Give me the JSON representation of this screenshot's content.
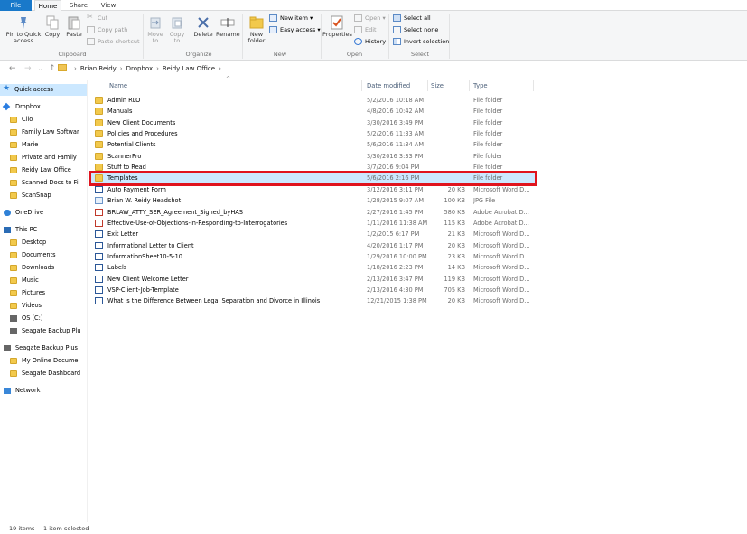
{
  "tabs": {
    "file": "File",
    "home": "Home",
    "share": "Share",
    "view": "View"
  },
  "ribbon": {
    "clipboard": {
      "pin": "Pin to Quick access",
      "copy": "Copy",
      "paste": "Paste",
      "cut": "Cut",
      "copy_path": "Copy path",
      "paste_shortcut": "Paste shortcut",
      "group": "Clipboard"
    },
    "organize": {
      "move_to": "Move to",
      "copy_to": "Copy to",
      "delete": "Delete",
      "rename": "Rename",
      "group": "Organize"
    },
    "new": {
      "new_folder": "New folder",
      "new_item": "New item",
      "easy_access": "Easy access",
      "group": "New"
    },
    "open": {
      "properties": "Properties",
      "open": "Open",
      "edit": "Edit",
      "history": "History",
      "group": "Open"
    },
    "select": {
      "select_all": "Select all",
      "select_none": "Select none",
      "invert": "Invert selection",
      "group": "Select"
    }
  },
  "address": {
    "crumbs": [
      "Brian Reidy",
      "Dropbox",
      "Reidy Law Office"
    ]
  },
  "sidebar": [
    {
      "label": "Quick access",
      "icon": "star-icon"
    },
    {
      "label": "Dropbox",
      "icon": "dropbox-icon"
    },
    {
      "label": "Clio",
      "icon": "folder-icon"
    },
    {
      "label": "Family Law Softwar",
      "icon": "folder-icon"
    },
    {
      "label": "Marie",
      "icon": "folder-icon"
    },
    {
      "label": "Private and Family",
      "icon": "folder-icon"
    },
    {
      "label": "Reidy Law Office",
      "icon": "folder-icon"
    },
    {
      "label": "Scanned Docs to Fil",
      "icon": "folder-icon"
    },
    {
      "label": "ScanSnap",
      "icon": "folder-icon"
    },
    {
      "label": "OneDrive",
      "icon": "cloud-icon"
    },
    {
      "label": "This PC",
      "icon": "pc-icon"
    },
    {
      "label": "Desktop",
      "icon": "folder-icon"
    },
    {
      "label": "Documents",
      "icon": "folder-icon"
    },
    {
      "label": "Downloads",
      "icon": "folder-icon"
    },
    {
      "label": "Music",
      "icon": "folder-icon"
    },
    {
      "label": "Pictures",
      "icon": "folder-icon"
    },
    {
      "label": "Videos",
      "icon": "folder-icon"
    },
    {
      "label": "OS (C:)",
      "icon": "drive-icon"
    },
    {
      "label": "Seagate Backup Plu",
      "icon": "drive-icon"
    },
    {
      "label": "Seagate Backup Plus",
      "icon": "drive-icon"
    },
    {
      "label": "My Online Docume",
      "icon": "folder-icon"
    },
    {
      "label": "Seagate Dashboard",
      "icon": "folder-icon"
    },
    {
      "label": "Network",
      "icon": "network-icon"
    }
  ],
  "columns": {
    "name": "Name",
    "date": "Date modified",
    "size": "Size",
    "type": "Type"
  },
  "files": [
    {
      "name": "Admin RLO",
      "date": "5/2/2016 10:18 AM",
      "size": "",
      "type": "File folder",
      "icon": "folder-icon"
    },
    {
      "name": "Manuals",
      "date": "4/8/2016 10:42 AM",
      "size": "",
      "type": "File folder",
      "icon": "folder-icon"
    },
    {
      "name": "New Client Documents",
      "date": "3/30/2016 3:49 PM",
      "size": "",
      "type": "File folder",
      "icon": "folder-icon"
    },
    {
      "name": "Policies and Procedures",
      "date": "5/2/2016 11:33 AM",
      "size": "",
      "type": "File folder",
      "icon": "folder-icon"
    },
    {
      "name": "Potential Clients",
      "date": "5/6/2016 11:34 AM",
      "size": "",
      "type": "File folder",
      "icon": "folder-icon"
    },
    {
      "name": "ScannerPro",
      "date": "3/30/2016 3:33 PM",
      "size": "",
      "type": "File folder",
      "icon": "folder-icon"
    },
    {
      "name": "Stuff to Read",
      "date": "3/7/2016 9:04 PM",
      "size": "",
      "type": "File folder",
      "icon": "folder-icon"
    },
    {
      "name": "Templates",
      "date": "5/6/2016 2:16 PM",
      "size": "",
      "type": "File folder",
      "icon": "folder-icon"
    },
    {
      "name": "Auto Payment Form",
      "date": "3/12/2016 3:11 PM",
      "size": "20 KB",
      "type": "Microsoft Word D...",
      "icon": "word-icon"
    },
    {
      "name": "Brian W. Reidy Headshot",
      "date": "1/28/2015 9:07 AM",
      "size": "100 KB",
      "type": "JPG File",
      "icon": "jpg-icon"
    },
    {
      "name": "BRLAW_ATTY_SER_Agreement_Signed_byHAS",
      "date": "2/27/2016 1:45 PM",
      "size": "580 KB",
      "type": "Adobe Acrobat D...",
      "icon": "pdf-icon"
    },
    {
      "name": "Effective-Use-of-Objections-in-Responding-to-Interrogatories",
      "date": "1/11/2016 11:38 AM",
      "size": "115 KB",
      "type": "Adobe Acrobat D...",
      "icon": "pdf-icon"
    },
    {
      "name": "Exit Letter",
      "date": "1/2/2015 6:17 PM",
      "size": "21 KB",
      "type": "Microsoft Word D...",
      "icon": "word-icon"
    },
    {
      "name": "Informational Letter to Client",
      "date": "4/20/2016 1:17 PM",
      "size": "20 KB",
      "type": "Microsoft Word D...",
      "icon": "word-icon"
    },
    {
      "name": "InformationSheet10-5-10",
      "date": "1/29/2016 10:00 PM",
      "size": "23 KB",
      "type": "Microsoft Word D...",
      "icon": "word-icon"
    },
    {
      "name": "Labels",
      "date": "1/18/2016 2:23 PM",
      "size": "14 KB",
      "type": "Microsoft Word D...",
      "icon": "word-icon"
    },
    {
      "name": "New Client Welcome Letter",
      "date": "2/13/2016 3:47 PM",
      "size": "119 KB",
      "type": "Microsoft Word D...",
      "icon": "word-icon"
    },
    {
      "name": "VSP-Client-Job-Template",
      "date": "2/13/2016 4:30 PM",
      "size": "705 KB",
      "type": "Microsoft Word D...",
      "icon": "word-icon"
    },
    {
      "name": "What is the Difference Between Legal Separation and Divorce in Illinois",
      "date": "12/21/2015 1:38 PM",
      "size": "20 KB",
      "type": "Microsoft Word D...",
      "icon": "word-icon"
    }
  ],
  "status": {
    "count": "19 items",
    "selected": "1 item selected"
  }
}
